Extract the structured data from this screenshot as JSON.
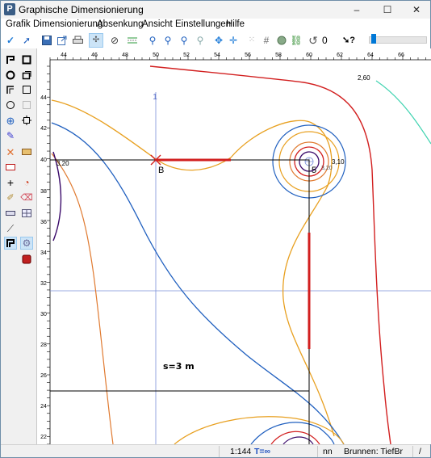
{
  "window": {
    "title": "Graphische Dimensionierung",
    "logo": "P"
  },
  "window_controls": {
    "minimize": "–",
    "maximize": "☐",
    "close": "✕"
  },
  "menu": [
    "Grafik",
    "Dimensionierung",
    "Absenkung",
    "Ansicht",
    "Einstellungen",
    "Hilfe"
  ],
  "toolbar": {
    "counter_value": "0",
    "icons": [
      "check-icon",
      "pointer-icon",
      "save-icon",
      "export-icon",
      "print-icon",
      "cross-pointer-icon",
      "rotate-icon",
      "measure-icon",
      "zoom-in-icon",
      "zoom-out-icon",
      "zoom-region-icon",
      "zoom-fit-icon",
      "pan-icon",
      "move-icon",
      "grid-dots-icon",
      "grid-icon",
      "globe-icon",
      "link-icon",
      "undo-icon",
      "help-pointer-icon"
    ],
    "slider_value": 0.05
  },
  "lefttools": {
    "icons": [
      "polyline-icon",
      "rectangle-icon",
      "circle-icon",
      "copy-icon",
      "corner-icon",
      "square-icon",
      "circle-outline-icon",
      "square-light-icon",
      "target-icon",
      "frame-icon",
      "pen-icon",
      "x-mark-icon",
      "rectangle-fill-icon",
      "rectangle-red-icon",
      "plus-icon",
      "pie-icon",
      "brush-icon",
      "eraser-icon",
      "ruler-icon",
      "grid-small-icon",
      "line-tool-icon",
      "corner-active-icon",
      "settings-icon",
      "color-icon"
    ]
  },
  "ruler": {
    "x_labels": [
      "44",
      "46",
      "48",
      "50",
      "52",
      "54",
      "56",
      "58",
      "60",
      "62",
      "64",
      "66"
    ],
    "y_labels": [
      "44",
      "42",
      "40",
      "38",
      "36",
      "34",
      "32",
      "30",
      "28",
      "26",
      "24",
      "22"
    ]
  },
  "drawing": {
    "point_label": "B",
    "well_label": "5",
    "dimension_text": "s=3 m",
    "axis_marker": "1",
    "iso_labels": [
      "2,60",
      "3,20",
      "3,10",
      "3,20"
    ],
    "colors": {
      "red": "#d21f1f",
      "orange": "#e8a020",
      "blue": "#1f5fbf",
      "dark_purple": "#3a0a6a",
      "teal": "#3fd3b0",
      "copper": "#e07a30",
      "guide_blue": "#7a8fd8"
    }
  },
  "status": {
    "scale": "1:144",
    "t_value": "T=∞",
    "units": "nn",
    "brunnen": "Brunnen: TiefBr",
    "extra": "/"
  }
}
